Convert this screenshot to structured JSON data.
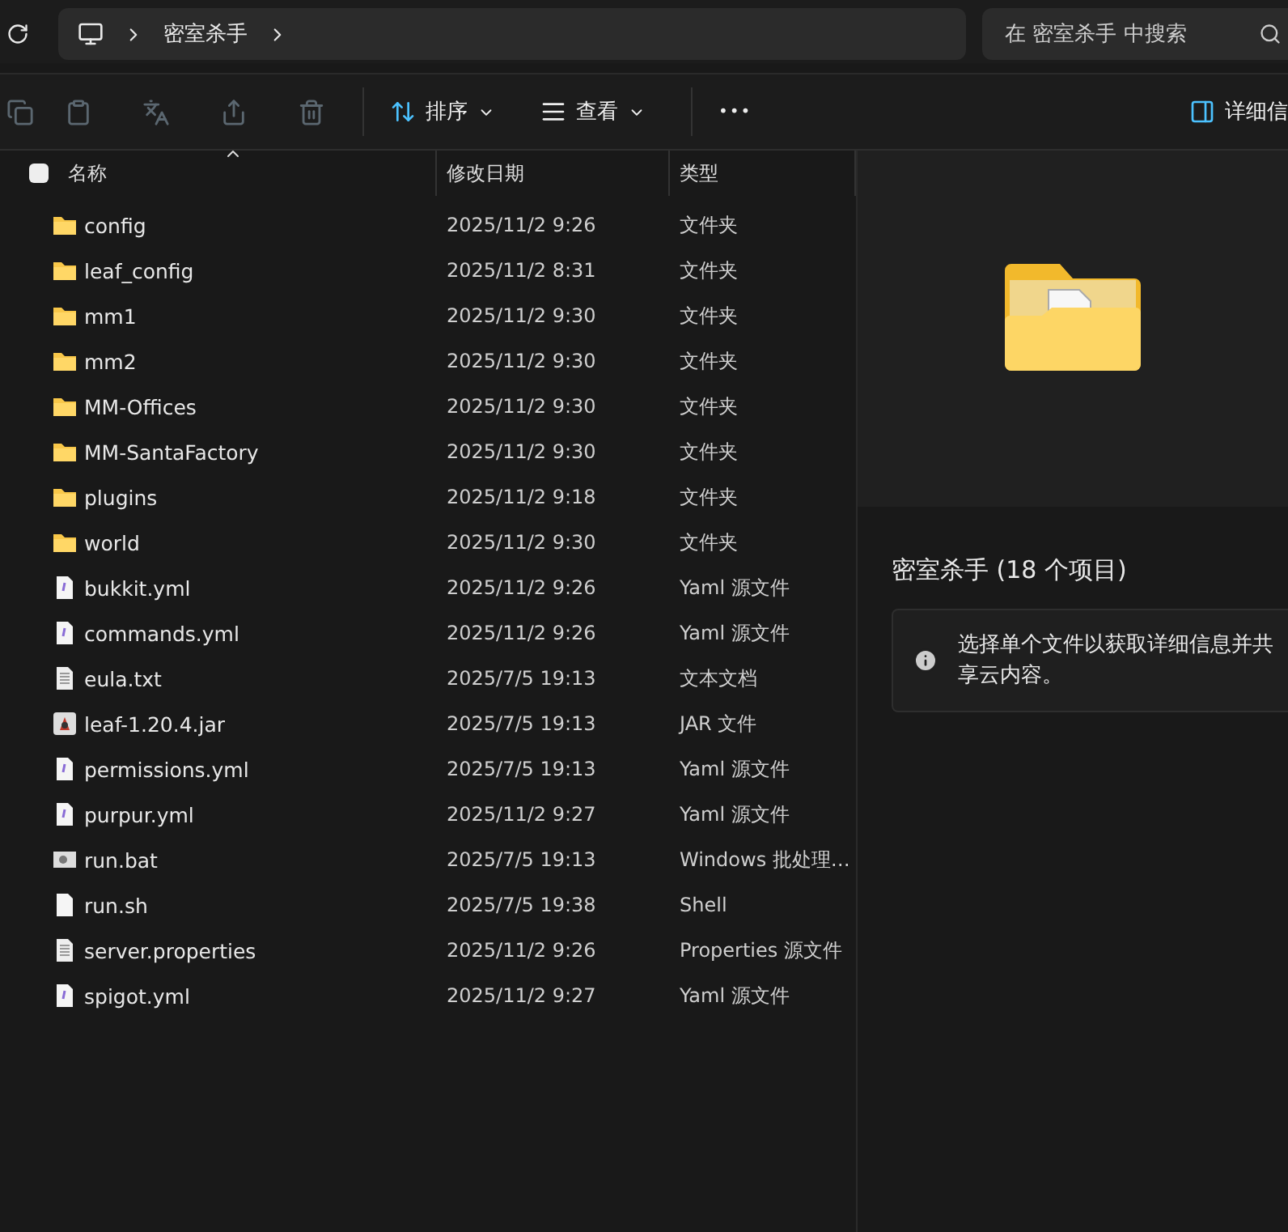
{
  "address_bar": {
    "segments": [
      "密室杀手"
    ]
  },
  "search": {
    "placeholder": "在 密室杀手 中搜索"
  },
  "toolbar": {
    "sort": "排序",
    "view": "查看",
    "more": "•••",
    "details": "详细信"
  },
  "table": {
    "columns": [
      "名称",
      "修改日期",
      "类型"
    ],
    "select_all_checked": false,
    "rows": [
      {
        "name": "config",
        "date": "2025/11/2 9:26",
        "type": "文件夹",
        "kind": "folder"
      },
      {
        "name": "leaf_config",
        "date": "2025/11/2 8:31",
        "type": "文件夹",
        "kind": "folder"
      },
      {
        "name": "mm1",
        "date": "2025/11/2 9:30",
        "type": "文件夹",
        "kind": "folder"
      },
      {
        "name": "mm2",
        "date": "2025/11/2 9:30",
        "type": "文件夹",
        "kind": "folder"
      },
      {
        "name": "MM-Offices",
        "date": "2025/11/2 9:30",
        "type": "文件夹",
        "kind": "folder"
      },
      {
        "name": "MM-SantaFactory",
        "date": "2025/11/2 9:30",
        "type": "文件夹",
        "kind": "folder"
      },
      {
        "name": "plugins",
        "date": "2025/11/2 9:18",
        "type": "文件夹",
        "kind": "folder"
      },
      {
        "name": "world",
        "date": "2025/11/2 9:30",
        "type": "文件夹",
        "kind": "folder"
      },
      {
        "name": "bukkit.yml",
        "date": "2025/11/2 9:26",
        "type": "Yaml 源文件",
        "kind": "yaml"
      },
      {
        "name": "commands.yml",
        "date": "2025/11/2 9:26",
        "type": "Yaml 源文件",
        "kind": "yaml"
      },
      {
        "name": "eula.txt",
        "date": "2025/7/5 19:13",
        "type": "文本文档",
        "kind": "text"
      },
      {
        "name": "leaf-1.20.4.jar",
        "date": "2025/7/5 19:13",
        "type": "JAR 文件",
        "kind": "jar"
      },
      {
        "name": "permissions.yml",
        "date": "2025/7/5 19:13",
        "type": "Yaml 源文件",
        "kind": "yaml"
      },
      {
        "name": "purpur.yml",
        "date": "2025/11/2 9:27",
        "type": "Yaml 源文件",
        "kind": "yaml"
      },
      {
        "name": "run.bat",
        "date": "2025/7/5 19:13",
        "type": "Windows 批处理…",
        "kind": "batch"
      },
      {
        "name": "run.sh",
        "date": "2025/7/5 19:38",
        "type": "Shell",
        "kind": "blank"
      },
      {
        "name": "server.properties",
        "date": "2025/11/2 9:26",
        "type": "Properties 源文件",
        "kind": "text"
      },
      {
        "name": "spigot.yml",
        "date": "2025/11/2 9:27",
        "type": "Yaml 源文件",
        "kind": "yaml"
      }
    ]
  },
  "details_pane": {
    "title": "密室杀手 (18 个项目)",
    "info": "选择单个文件以获取详细信息并共享云内容。"
  }
}
